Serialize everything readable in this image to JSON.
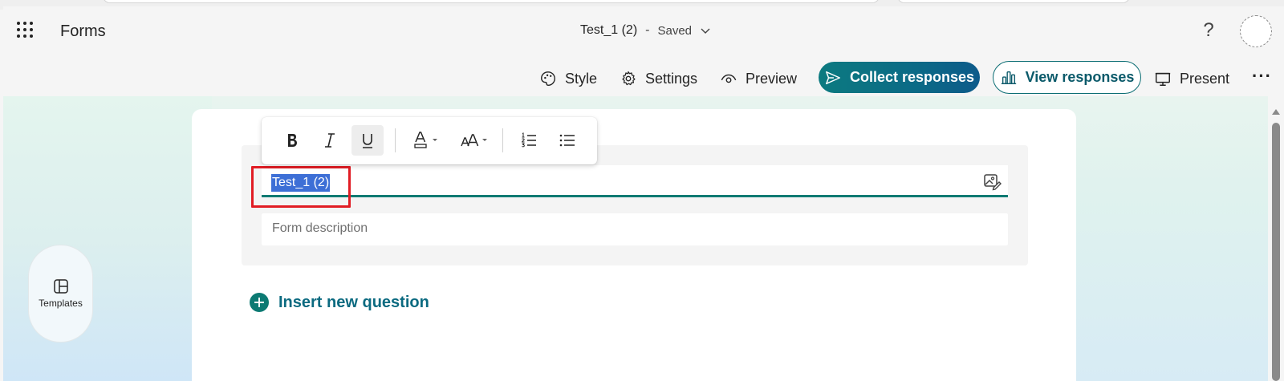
{
  "app": {
    "name": "Forms"
  },
  "document": {
    "title": "Test_1 (2)",
    "separator": "-",
    "status": "Saved"
  },
  "header": {
    "help_label": "?"
  },
  "commands": {
    "style": "Style",
    "settings": "Settings",
    "preview": "Preview",
    "collect": "Collect responses",
    "view": "View responses",
    "present": "Present",
    "more": "···"
  },
  "sidebar": {
    "templates": "Templates"
  },
  "form": {
    "title_value": "Test_1 (2)",
    "description_placeholder": "Form description",
    "insert_question": "Insert new question"
  },
  "colors": {
    "accent": "#0c7a73",
    "selection": "#3d6fd6",
    "highlight": "#e11c24"
  }
}
